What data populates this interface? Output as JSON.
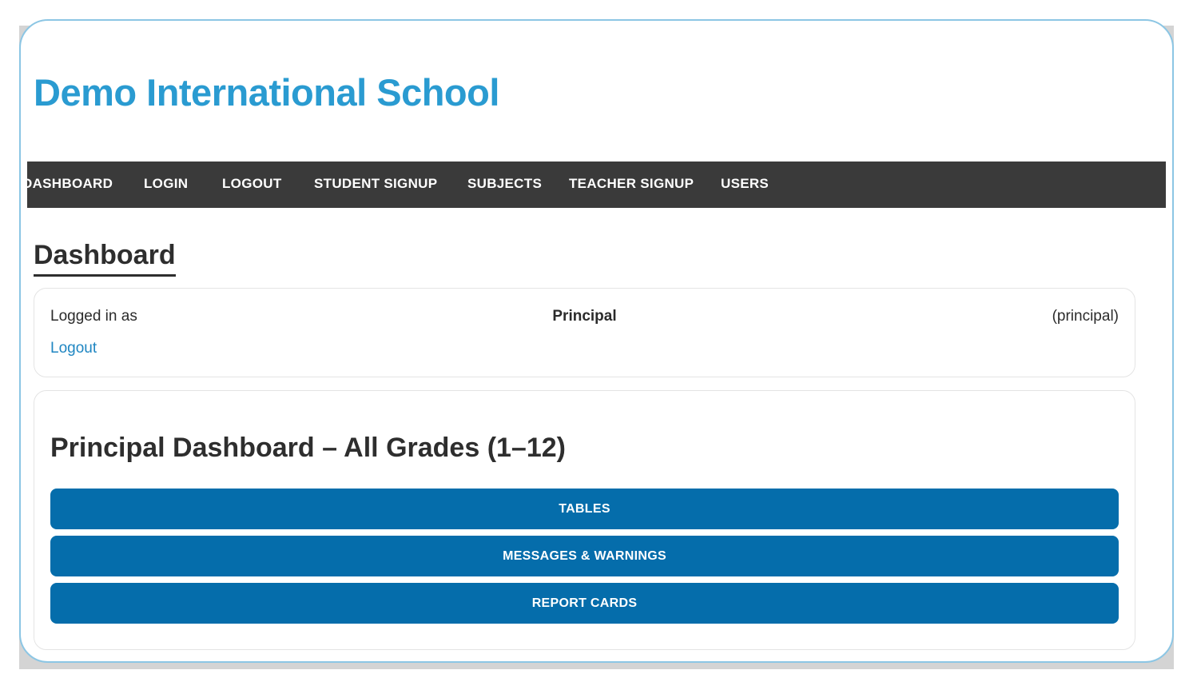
{
  "site": {
    "title": "Demo International School"
  },
  "nav": {
    "items": [
      {
        "label": "DASHBOARD"
      },
      {
        "label": "LOGIN"
      },
      {
        "label": "LOGOUT"
      },
      {
        "label": "STUDENT SIGNUP"
      },
      {
        "label": "SUBJECTS"
      },
      {
        "label": "TEACHER SIGNUP"
      },
      {
        "label": "USERS"
      }
    ]
  },
  "page": {
    "heading": "Dashboard"
  },
  "login_card": {
    "prefix": "Logged in as",
    "user_name": "Principal",
    "role": "(principal)",
    "logout_label": "Logout"
  },
  "dashboard_card": {
    "heading": "Principal Dashboard – All Grades (1–12)",
    "buttons": [
      {
        "label": "TABLES"
      },
      {
        "label": "MESSAGES & WARNINGS"
      },
      {
        "label": "REPORT CARDS"
      }
    ]
  },
  "colors": {
    "title": "#2a9bd1",
    "navbar": "#3a3a3a",
    "button": "#056dab",
    "link": "#1f86c2",
    "frame_border": "#8cc6e4"
  }
}
